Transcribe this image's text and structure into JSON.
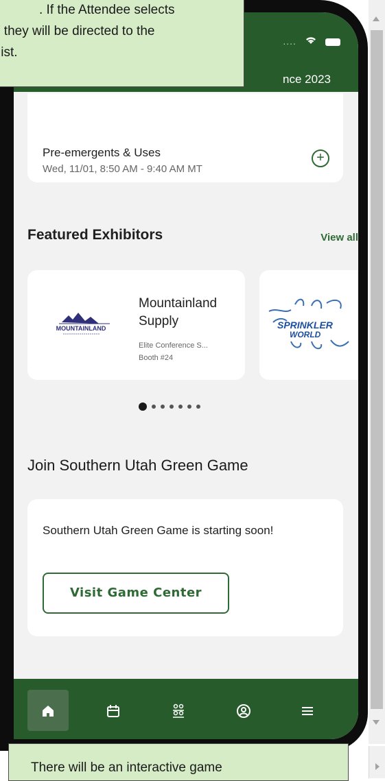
{
  "status_bar": {
    "signal": "....",
    "wifi_icon": "wifi-icon",
    "battery_icon": "battery-icon"
  },
  "header": {
    "title": "nce 2023"
  },
  "session": {
    "title": "Pre-emergents & Uses",
    "time": "Wed, 11/01, 8:50 AM - 9:40 AM MT",
    "add_symbol": "+"
  },
  "featured": {
    "title": "Featured Exhibitors",
    "view_all": "View all",
    "exhibitors": [
      {
        "name": "Mountainland Supply",
        "category": "Elite Conference S...",
        "booth": "Booth #24",
        "logo_text": "MOUNTAINLAND"
      },
      {
        "logo_text_1": "SPRINKLER",
        "logo_text_2": "WORLD"
      }
    ],
    "carousel_pages": 7,
    "carousel_active": 1
  },
  "game": {
    "title": "Join Southern Utah Green Game",
    "description": "Southern Utah Green Game is starting soon!",
    "button": "Visit Game Center"
  },
  "tabs": [
    {
      "name": "home",
      "icon": "home-icon"
    },
    {
      "name": "agenda",
      "icon": "calendar-icon"
    },
    {
      "name": "people",
      "icon": "people-icon"
    },
    {
      "name": "profile",
      "icon": "profile-icon"
    },
    {
      "name": "menu",
      "icon": "menu-icon"
    }
  ],
  "colors": {
    "brand_green": "#285b2c",
    "accent_green": "#2f6a35",
    "callout_bg": "#d5ecc6"
  },
  "callouts": {
    "top_line_1": ". If the Attendee selects",
    "top_line_2": "’ they will be directed to the",
    "top_line_3": "list.",
    "bottom": "There will be an interactive game"
  }
}
